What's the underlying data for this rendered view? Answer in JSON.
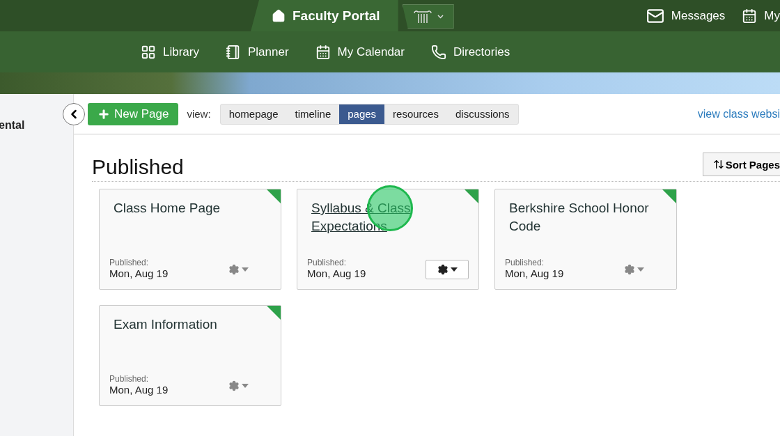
{
  "top_bar": {
    "portal_title": "Faculty Portal",
    "right_links": [
      {
        "kind": "mail",
        "label": "Messages"
      },
      {
        "kind": "calendar",
        "label": "My"
      }
    ]
  },
  "nav": {
    "items": [
      {
        "kind": "grid",
        "label": "Library"
      },
      {
        "kind": "planner",
        "label": "Planner"
      },
      {
        "kind": "calendar",
        "label": "My Calendar"
      },
      {
        "kind": "phone",
        "label": "Directories"
      }
    ]
  },
  "sidebar": {
    "text": "ental"
  },
  "toolbar": {
    "new_button": "New Page",
    "view_label": "view:",
    "tabs": [
      {
        "label": "homepage",
        "selected": false
      },
      {
        "label": "timeline",
        "selected": false
      },
      {
        "label": "pages",
        "selected": true
      },
      {
        "label": "resources",
        "selected": false
      },
      {
        "label": "discussions",
        "selected": false
      }
    ],
    "site_link": "view class websi"
  },
  "section": {
    "title": "Published",
    "sort_button": "Sort Pages"
  },
  "cards": [
    {
      "title": "Class Home Page",
      "status_label": "Published:",
      "date": "Mon, Aug 19",
      "hovered": false
    },
    {
      "title": "Syllabus & Class Expectations",
      "status_label": "Published:",
      "date": "Mon, Aug 19",
      "hovered": true
    },
    {
      "title": "Berkshire School Honor Code",
      "status_label": "Published:",
      "date": "Mon, Aug 19",
      "hovered": false
    },
    {
      "title": "Exam Information",
      "status_label": "Published:",
      "date": "Mon, Aug 19",
      "hovered": false
    }
  ]
}
